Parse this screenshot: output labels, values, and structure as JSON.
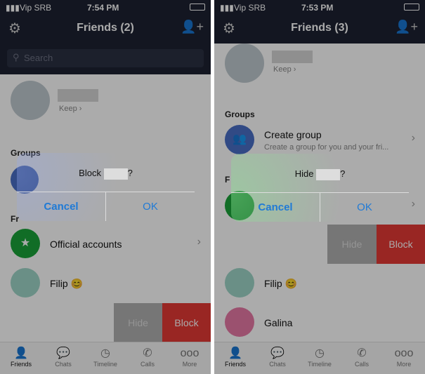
{
  "screens": [
    {
      "status": {
        "carrier": "Vip SRB",
        "time": "7:54 PM"
      },
      "header": {
        "title": "Friends (2)"
      },
      "search_placeholder": "Search",
      "profile": {
        "keep": "Keep ›"
      },
      "groups_label": "Groups",
      "friends_label": "Fr",
      "rows": [
        {
          "name": "Official accounts"
        },
        {
          "name": "Filip 😊"
        }
      ],
      "swipe": {
        "hide": "Hide",
        "block": "Block"
      },
      "dialog": {
        "prefix": "Block",
        "suffix": "?",
        "cancel": "Cancel",
        "ok": "OK"
      }
    },
    {
      "status": {
        "carrier": "Vip SRB",
        "time": "7:53 PM"
      },
      "header": {
        "title": "Friends (3)"
      },
      "profile": {
        "keep": "Keep ›"
      },
      "groups_label": "Groups",
      "create_group": {
        "title": "Create group",
        "subtitle": "Create a group for you and your fri..."
      },
      "friends_label": "F",
      "rows": [
        {
          "name": "Filip 😊"
        },
        {
          "name": "Galina"
        }
      ],
      "swipe": {
        "hide": "Hide",
        "block": "Block"
      },
      "dialog": {
        "prefix": "Hide",
        "suffix": "?",
        "cancel": "Cancel",
        "ok": "OK"
      }
    }
  ],
  "tabs": [
    {
      "label": "Friends",
      "icon": "person-icon"
    },
    {
      "label": "Chats",
      "icon": "chat-bubble-icon"
    },
    {
      "label": "Timeline",
      "icon": "clock-icon"
    },
    {
      "label": "Calls",
      "icon": "phone-icon"
    },
    {
      "label": "More",
      "icon": "more-dots-icon"
    }
  ],
  "colors": {
    "header": "#1d2232",
    "block": "#e53935",
    "accent": "#1f7ad6",
    "official": "#1aa33a",
    "group": "#4a6fc7"
  }
}
